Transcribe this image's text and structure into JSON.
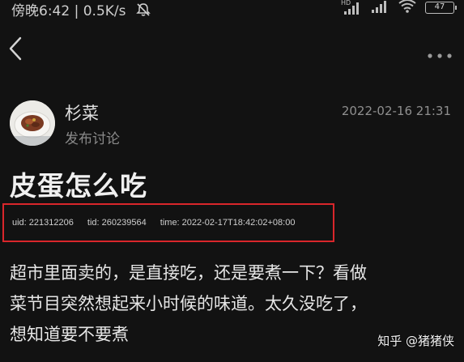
{
  "status_bar": {
    "time": "傍晚6:42",
    "speed": "0.5K/s",
    "network_label": "HD",
    "battery": "47",
    "icons": [
      "mute-icon",
      "signal-icon",
      "signal-icon",
      "wifi-icon",
      "battery-icon"
    ]
  },
  "nav": {
    "back_icon": "chevron-left-icon",
    "more_icon": "more-dots-icon"
  },
  "post": {
    "author": "杉菜",
    "subtitle": "发布讨论",
    "time": "2022-02-16 21:31",
    "title": "皮蛋怎么吃",
    "meta": {
      "uid": "uid: 221312206",
      "tid": "tid: 260239564",
      "time": "time: 2022-02-17T18:42:02+08:00"
    },
    "body_lines": [
      "超市里面卖的，是直接吃，还是要煮一下？看做",
      "菜节目突然想起来小时候的味道。太久没吃了，",
      "想知道要不要煮"
    ]
  },
  "watermark": "知乎 @猪猪侠",
  "colors": {
    "background": "#121212",
    "highlight_box": "#d9262b"
  }
}
